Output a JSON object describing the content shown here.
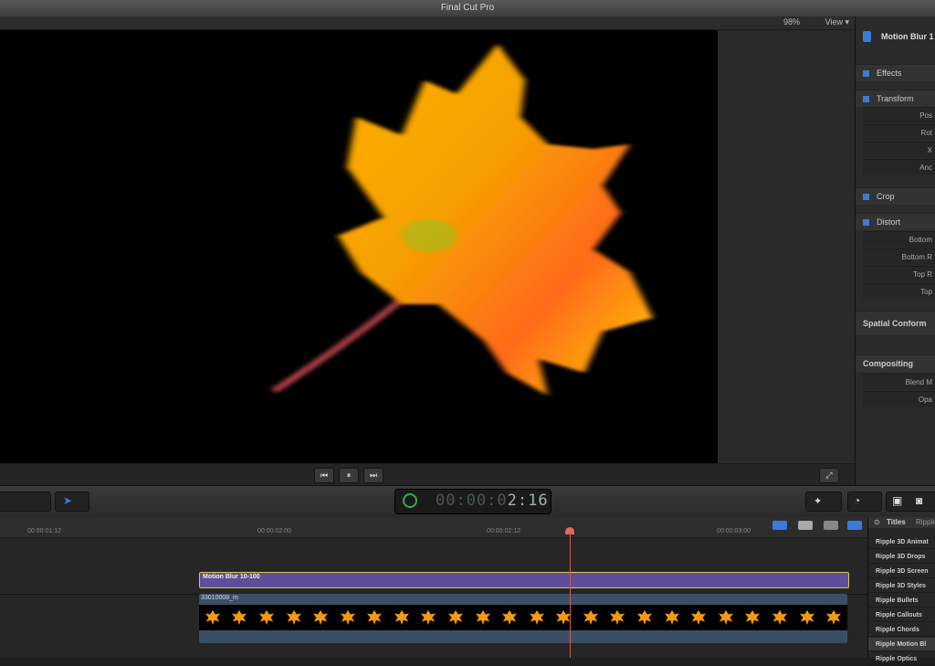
{
  "app": {
    "title": "Final Cut Pro"
  },
  "viewer": {
    "zoom": "98%",
    "view_label": "View"
  },
  "transport": {
    "prev": "⏮",
    "pause": "⏸",
    "next": "⏭",
    "fullscreen": "⤢"
  },
  "inspector": {
    "clip_name": "Motion Blur 1",
    "sections": {
      "effects": "Effects",
      "transform": "Transform",
      "crop": "Crop",
      "distort": "Distort",
      "spatial": "Spatial Conform",
      "compositing": "Compositing"
    },
    "transform_rows": [
      "Pos",
      "Rot",
      "X",
      "Anc"
    ],
    "distort_rows": [
      "Bottom",
      "Bottom R",
      "Top R",
      "Top"
    ],
    "compositing_rows": [
      "Blend M",
      "Opa"
    ]
  },
  "toolbar": {
    "timecode": "2:16",
    "timecode_dim": "00:00:0"
  },
  "timeline": {
    "ruler_labels": [
      "00:00:01:12",
      "00:00:02:00",
      "00:00:02:12",
      "00:00:03:00"
    ],
    "title_clip": "Motion Blur 10-100",
    "video_clip": "33010008_m",
    "frame_count": 24
  },
  "browser": {
    "header": "Titles",
    "header_extra": "Ripple",
    "items": [
      "Ripple 3D Animat",
      "Ripple 3D Drops",
      "Ripple 3D Screen",
      "Ripple 3D Styles",
      "Ripple Bullets",
      "Ripple Callouts",
      "Ripple Chords",
      "Ripple Motion Bl",
      "Ripple Optics"
    ],
    "selected_index": 7
  },
  "colors": {
    "accent": "#3b7bdc",
    "title_clip": "#5d4e9a",
    "playhead": "#d45a4a"
  }
}
